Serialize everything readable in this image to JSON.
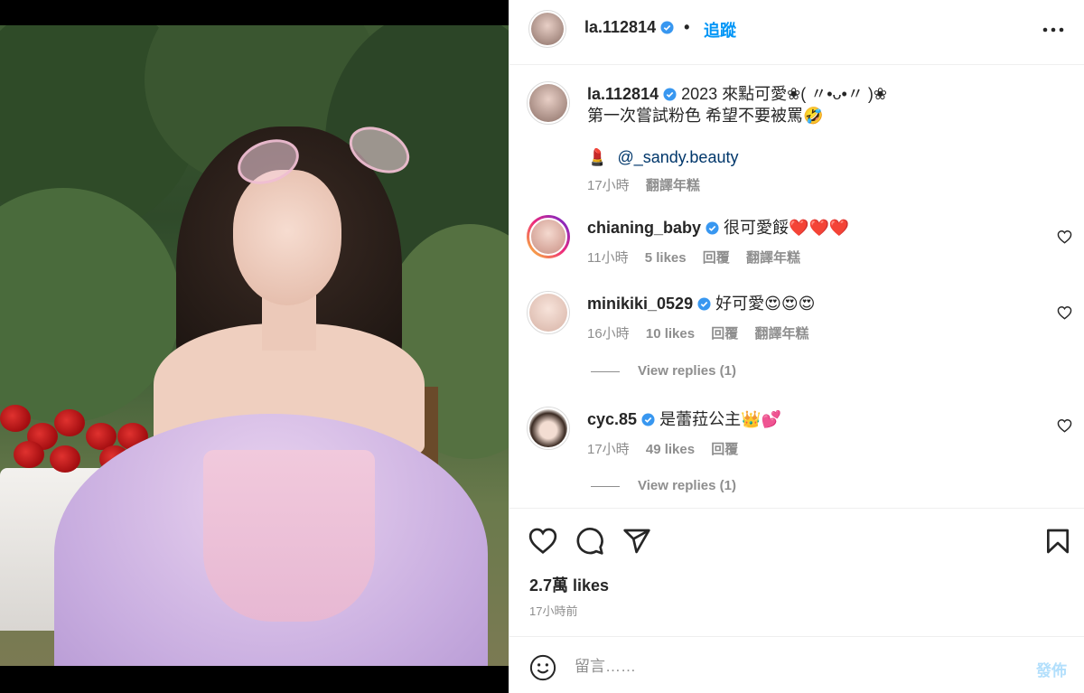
{
  "post": {
    "author": "la.112814",
    "follow_label": "追蹤",
    "caption_line1": "2023 來點可愛❀( 〃•ᴗ•〃 )❀",
    "caption_line2": "第一次嘗試粉色 希望不要被罵🤣",
    "caption_mention_emoji": "💄",
    "caption_mention": "@_sandy.beauty",
    "caption_time": "17小時",
    "caption_translate": "翻譯年糕"
  },
  "comments": [
    {
      "user": "chianing_baby",
      "text": "很可愛餒❤️❤️❤️",
      "time": "11小時",
      "likes": "5 likes",
      "reply": "回覆",
      "translate": "翻譯年糕"
    },
    {
      "user": "minikiki_0529",
      "text": "好可愛😍😍😍",
      "time": "16小時",
      "likes": "10 likes",
      "reply": "回覆",
      "translate": "翻譯年糕",
      "view_replies": "View replies (1)"
    },
    {
      "user": "cyc.85",
      "text": "是蕾菈公主👑💕",
      "time": "17小時",
      "likes": "49 likes",
      "reply": "回覆",
      "view_replies": "View replies (1)"
    }
  ],
  "actions": {
    "likes": "2.7萬 likes",
    "time": "17小時前"
  },
  "comment_box": {
    "placeholder": "留言……",
    "post_label": "發佈"
  },
  "colors": {
    "accent": "#0095f6",
    "verified": "#3897f0",
    "muted": "#8e8e8e",
    "post_disabled": "#b2dffc"
  },
  "icons": [
    "more-icon",
    "verified-icon",
    "heart-icon",
    "comment-icon",
    "share-icon",
    "bookmark-icon",
    "emoji-icon"
  ]
}
